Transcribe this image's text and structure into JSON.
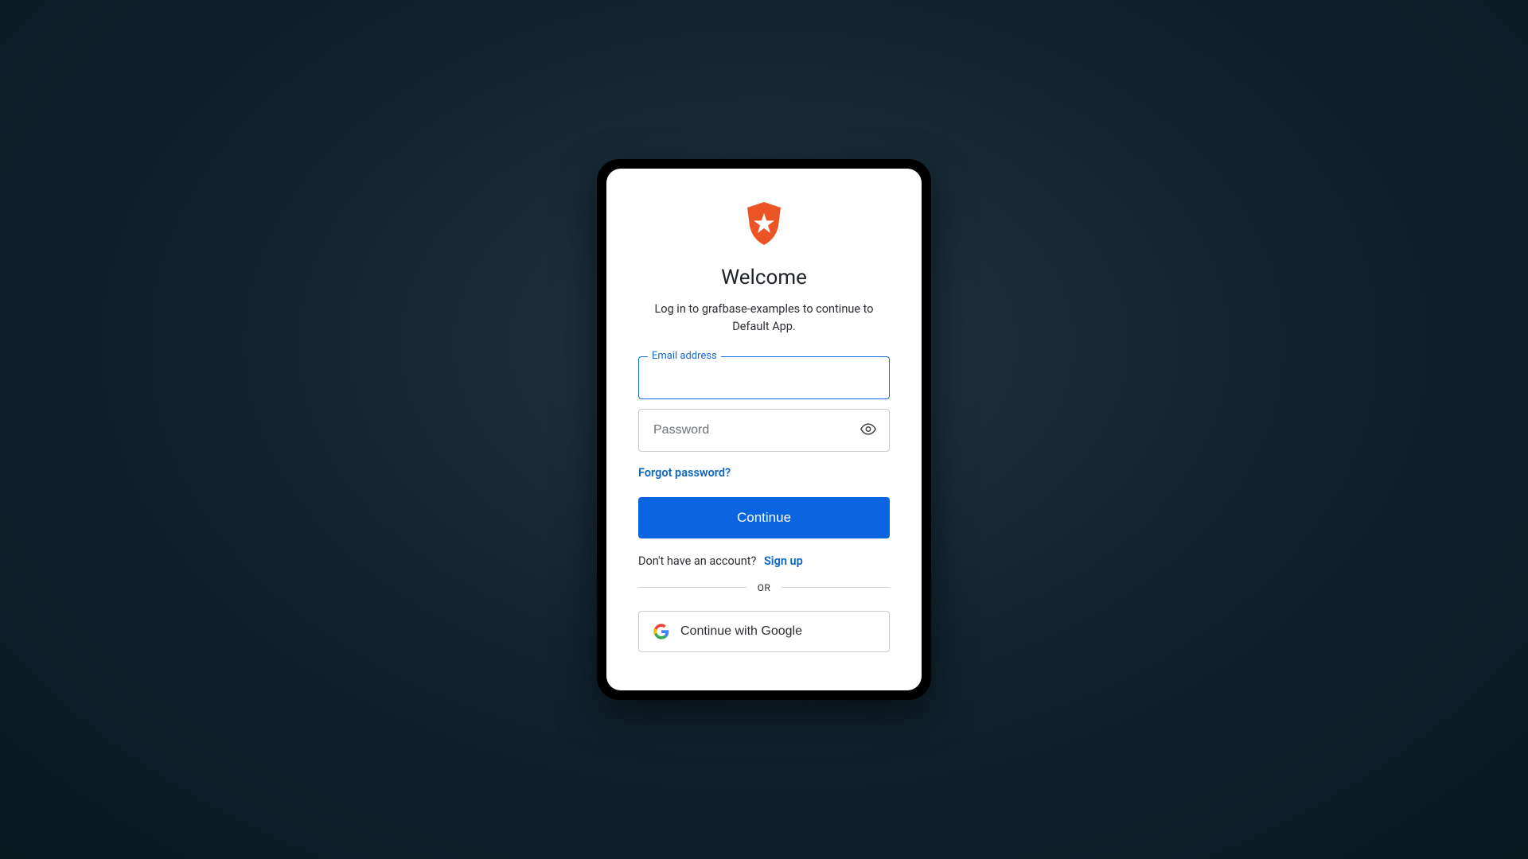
{
  "title": "Welcome",
  "subtitle": "Log in to grafbase-examples to continue to Default App.",
  "email": {
    "label": "Email address",
    "value": ""
  },
  "password": {
    "placeholder": "Password",
    "value": ""
  },
  "forgot": "Forgot password?",
  "continue": "Continue",
  "signup_prompt": "Don't have an account?",
  "signup_link": "Sign up",
  "divider": "OR",
  "google": "Continue with Google"
}
